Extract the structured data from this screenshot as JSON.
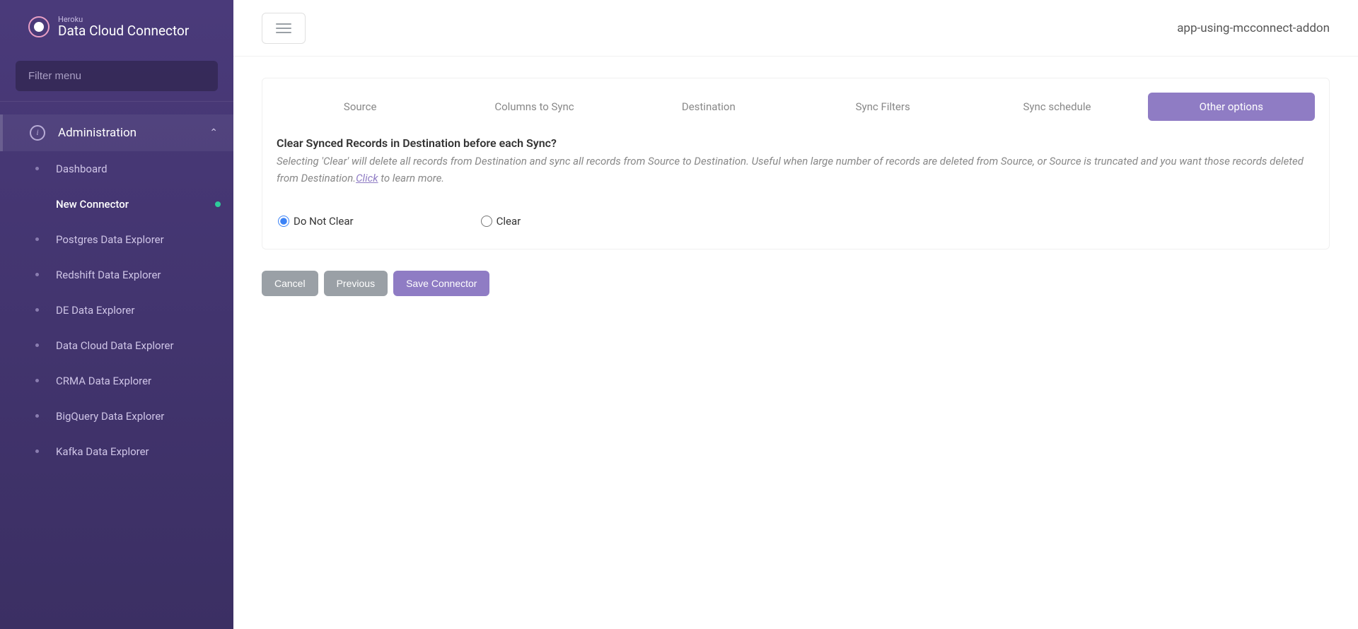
{
  "header": {
    "subtitle": "Heroku",
    "title": "Data Cloud Connector"
  },
  "sidebar": {
    "filter_placeholder": "Filter menu",
    "section_label": "Administration",
    "items": [
      {
        "label": "Dashboard"
      },
      {
        "label": "New Connector",
        "active": true
      },
      {
        "label": "Postgres Data Explorer"
      },
      {
        "label": "Redshift Data Explorer"
      },
      {
        "label": "DE Data Explorer"
      },
      {
        "label": "Data Cloud Data Explorer"
      },
      {
        "label": "CRMA Data Explorer"
      },
      {
        "label": "BigQuery Data Explorer"
      },
      {
        "label": "Kafka Data Explorer"
      }
    ]
  },
  "topbar": {
    "app_name": "app-using-mcconnect-addon"
  },
  "tabs": [
    {
      "label": "Source"
    },
    {
      "label": "Columns to Sync"
    },
    {
      "label": "Destination"
    },
    {
      "label": "Sync Filters"
    },
    {
      "label": "Sync schedule"
    },
    {
      "label": "Other options",
      "active": true
    }
  ],
  "panel": {
    "heading": "Clear Synced Records in Destination before each Sync?",
    "description": "Selecting 'Clear' will delete all records from Destination and sync all records from Source to Destination. Useful when large number of records are deleted from Source, or Source is truncated and you want those records deleted from Destination.",
    "link_text": "Click",
    "desc_suffix": " to learn more.",
    "options": {
      "do_not_clear": "Do Not Clear",
      "clear": "Clear"
    }
  },
  "buttons": {
    "cancel": "Cancel",
    "previous": "Previous",
    "save": "Save Connector"
  }
}
